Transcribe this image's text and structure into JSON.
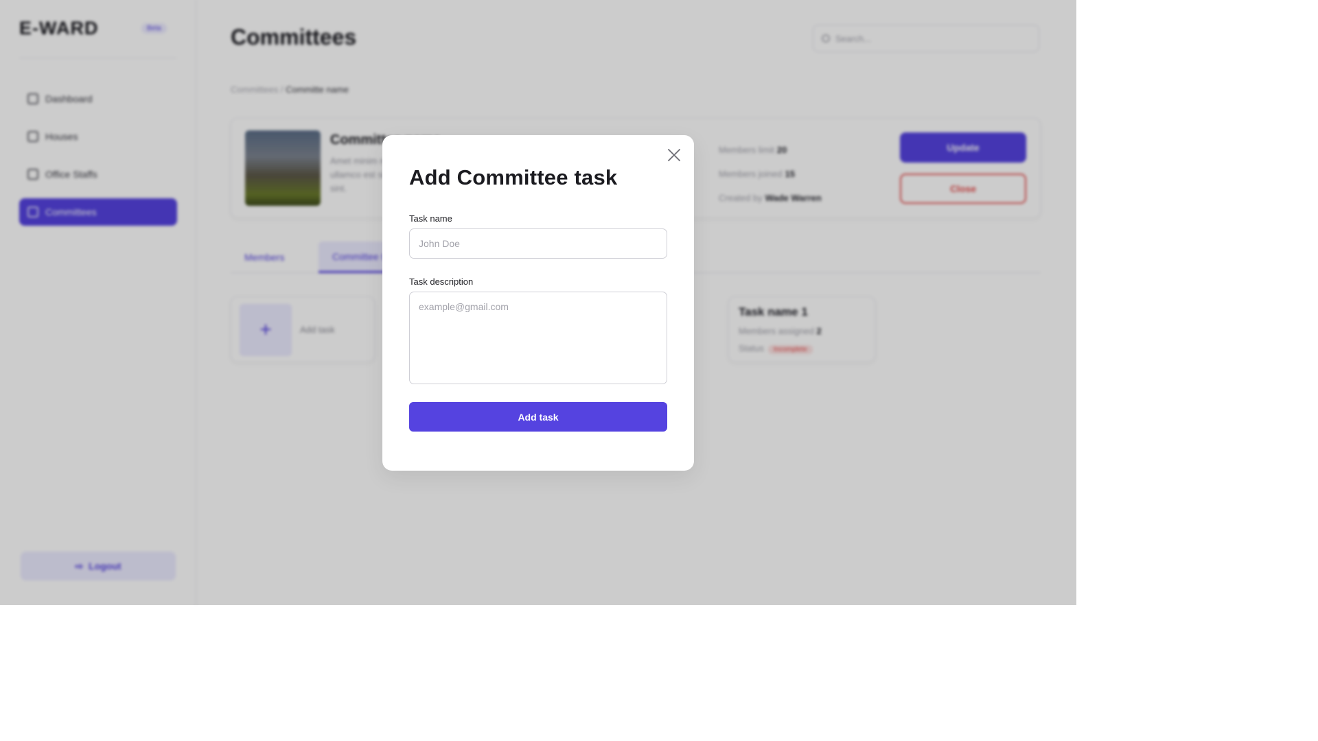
{
  "sidebar": {
    "logo": "E-WARD",
    "badge": "Beta",
    "items": [
      {
        "label": "Dashboard"
      },
      {
        "label": "Houses"
      },
      {
        "label": "Office Staffs"
      },
      {
        "label": "Committees"
      }
    ],
    "logout_label": "Logout"
  },
  "header": {
    "title": "Committees",
    "search_placeholder": "Search..."
  },
  "breadcrumb": {
    "root": "Committees",
    "separator": " / ",
    "current": "Committe name"
  },
  "committee": {
    "name": "Committee name",
    "description": "Amet minim mollit non deserunt ullamco est sit aliqua dolor do amet sint.",
    "members_limit_label": "Members limit",
    "members_limit": "20",
    "members_joined_label": "Members joined",
    "members_joined": "15",
    "created_by_label": "Created by",
    "created_by": "Wade Warren",
    "update_label": "Update",
    "close_label": "Close"
  },
  "tabs": [
    {
      "label": "Members"
    },
    {
      "label": "Committee tasks"
    }
  ],
  "tasks": {
    "add_label": "Add task",
    "card": {
      "title": "Task name 1",
      "members_label": "Members assigned",
      "members_value": "2",
      "status_label": "Status",
      "status_value": "Incomplete"
    }
  },
  "modal": {
    "title": "Add Committee task",
    "task_name_label": "Task name",
    "task_name_placeholder": "John Doe",
    "task_description_label": "Task description",
    "task_description_placeholder": "example@gmail.com",
    "submit_label": "Add task"
  },
  "colors": {
    "accent": "#5543e0",
    "danger": "#e64a4a",
    "overlay": "rgba(0,0,0,0.2)"
  }
}
